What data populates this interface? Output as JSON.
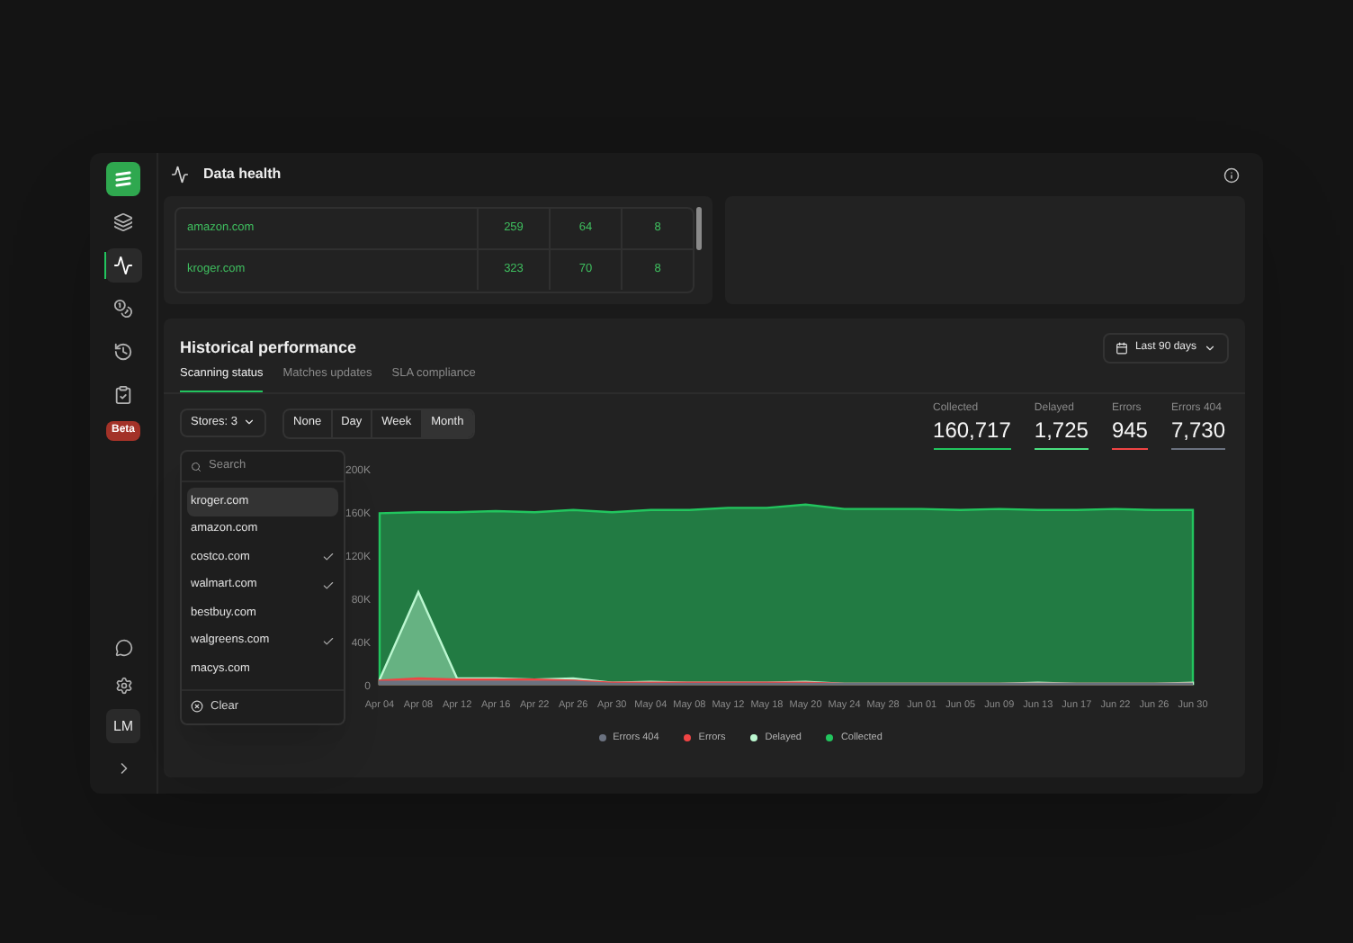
{
  "sidebar": {
    "nav_items": [
      {
        "kind": "layers",
        "selected": false
      },
      {
        "kind": "activity",
        "selected": true
      },
      {
        "kind": "coins",
        "selected": false
      },
      {
        "kind": "history",
        "selected": false
      },
      {
        "kind": "clipboard",
        "selected": false
      }
    ],
    "badge": "Beta",
    "avatar": "LM"
  },
  "header": {
    "title": "Data health"
  },
  "store_table": {
    "rows": [
      {
        "store": "amazon.com",
        "column_2": "259",
        "column_3": "64",
        "column_4": "8"
      },
      {
        "store": "kroger.com",
        "column_2": "323",
        "column_3": "70",
        "column_4": "8"
      }
    ]
  },
  "historical": {
    "title": "Historical performance",
    "date_range": "Last 90 days",
    "tabs": [
      {
        "label": "Scanning status",
        "selected": true
      },
      {
        "label": "Matches updates",
        "selected": false
      },
      {
        "label": "SLA compliance",
        "selected": false
      }
    ],
    "stores_button": "Stores: 3",
    "periods": [
      {
        "label": "None",
        "selected": false
      },
      {
        "label": "Day",
        "selected": false
      },
      {
        "label": "Week",
        "selected": false
      },
      {
        "label": "Month",
        "selected": true
      }
    ],
    "stats": [
      {
        "label": "Collected",
        "value": "160,717",
        "color": "#22c55e"
      },
      {
        "label": "Delayed",
        "value": "1,725",
        "color": "#4ade80"
      },
      {
        "label": "Errors",
        "value": "945",
        "color": "#ef4444"
      },
      {
        "label": "Errors 404",
        "value": "7,730",
        "color": "#6b7280"
      }
    ],
    "store_menu": {
      "search_placeholder": "Search",
      "items": [
        {
          "label": "kroger.com",
          "selected": true,
          "checked": false
        },
        {
          "label": "amazon.com",
          "selected": false,
          "checked": false
        },
        {
          "label": "costco.com",
          "selected": false,
          "checked": true
        },
        {
          "label": "walmart.com",
          "selected": false,
          "checked": true
        },
        {
          "label": "bestbuy.com",
          "selected": false,
          "checked": false
        },
        {
          "label": "walgreens.com",
          "selected": false,
          "checked": true
        },
        {
          "label": "macys.com",
          "selected": false,
          "checked": false
        }
      ],
      "clear": "Clear"
    },
    "chart_data": {
      "type": "area",
      "categories": [
        "Apr 04",
        "Apr 08",
        "Apr 12",
        "Apr 16",
        "Apr 22",
        "Apr 26",
        "Apr 30",
        "May 04",
        "May 08",
        "May 12",
        "May 18",
        "May 20",
        "May 24",
        "May 28",
        "Jun 01",
        "Jun 05",
        "Jun 09",
        "Jun 13",
        "Jun 17",
        "Jun 22",
        "Jun 26",
        "Jun 30"
      ],
      "ylim": [
        0,
        200000
      ],
      "yticks": [
        {
          "value": 0,
          "label": "0"
        },
        {
          "value": 40000,
          "label": "40K"
        },
        {
          "value": 80000,
          "label": "80K"
        },
        {
          "value": 120000,
          "label": "120K"
        },
        {
          "value": 160000,
          "label": "160K"
        },
        {
          "value": 200000,
          "label": "200K"
        }
      ],
      "series": [
        {
          "name": "Collected",
          "color": "#22c55e",
          "values": [
            158000,
            159000,
            159000,
            160000,
            159000,
            161000,
            159000,
            161000,
            161000,
            163000,
            163000,
            166000,
            162000,
            162000,
            162000,
            161000,
            162000,
            161000,
            161000,
            162000,
            161000,
            161000
          ]
        },
        {
          "name": "Delayed",
          "color": "#bbf7d0",
          "values": [
            4000,
            85000,
            5000,
            5000,
            4000,
            5000,
            1000,
            2000,
            1000,
            1000,
            1000,
            2000,
            0,
            0,
            0,
            0,
            0,
            1000,
            0,
            0,
            0,
            1000
          ]
        },
        {
          "name": "Errors",
          "color": "#ef4444",
          "values": [
            3000,
            5000,
            4000,
            4000,
            4000,
            3000,
            1000,
            1000,
            1000,
            1000,
            1000,
            1000,
            0,
            0,
            0,
            0,
            0,
            0,
            0,
            0,
            0,
            0
          ]
        },
        {
          "name": "Errors 404",
          "color": "#6b7280",
          "values": [
            2000,
            2000,
            2000,
            2000,
            2000,
            2000,
            0,
            0,
            0,
            0,
            0,
            0,
            0,
            0,
            0,
            0,
            0,
            0,
            0,
            0,
            0,
            0
          ]
        }
      ]
    }
  }
}
